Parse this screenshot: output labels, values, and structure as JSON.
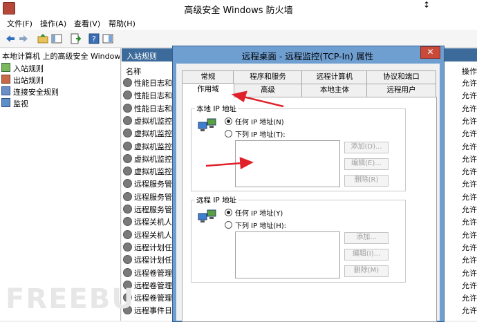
{
  "window": {
    "title": "高级安全 Windows 防火墙",
    "cursor_glyph": "↕"
  },
  "menu": [
    "文件(F)",
    "操作(A)",
    "查看(V)",
    "帮助(H)"
  ],
  "tree": {
    "root": "本地计算机 上的高级安全 Windows",
    "items": [
      "入站规则",
      "出站规则",
      "连接安全规则",
      "监视"
    ]
  },
  "list": {
    "pane_title": "入站规则",
    "col_name": "名称",
    "col_ops": "操作",
    "rows": [
      "性能日志和",
      "性能日志和",
      "性能日志和",
      "虚拟机监控",
      "虚拟机监控",
      "虚拟机监控",
      "虚拟机监控",
      "虚拟机监控",
      "远程服务管",
      "远程服务管",
      "远程服务管",
      "远程关机人",
      "远程关机人",
      "远程计划任",
      "远程计划任",
      "远程卷管理",
      "远程卷管理",
      "远程卷管理",
      "远程事件日"
    ],
    "ops": [
      "允许",
      "允许",
      "允许",
      "允许",
      "允许",
      "允许",
      "允许",
      "允许",
      "允许",
      "允许",
      "允许",
      "允许",
      "允许",
      "允许",
      "允许",
      "允许",
      "允许",
      "允许",
      "允许"
    ]
  },
  "dialog": {
    "title": "远程桌面 - 远程监控(TCP-In) 属性",
    "close_glyph": "✕",
    "tabs_row1": [
      "常规",
      "程序和服务",
      "远程计算机",
      "协议和端口"
    ],
    "tabs_row2": [
      "作用域",
      "高级",
      "本地主体",
      "远程用户"
    ],
    "local": {
      "title": "本地 IP 地址",
      "opt_any": "任何 IP 地址(N)",
      "opt_list": "下列 IP 地址(T):",
      "btn_add": "添加(D)...",
      "btn_edit": "编辑(E)...",
      "btn_remove": "删除(R)"
    },
    "remote": {
      "title": "远程 IP 地址",
      "opt_any": "任何 IP 地址(Y)",
      "opt_list": "下列 IP 地址(H):",
      "btn_add": "添加...",
      "btn_edit": "编辑(I)...",
      "btn_remove": "删除(M)"
    }
  },
  "watermark": "FREEBU",
  "colors": {
    "list_header": "#3c6a9a",
    "dialog_frame": "#6f9ed1",
    "close_button": "#c94a3a",
    "annotation_arrow": "#e0202a"
  }
}
